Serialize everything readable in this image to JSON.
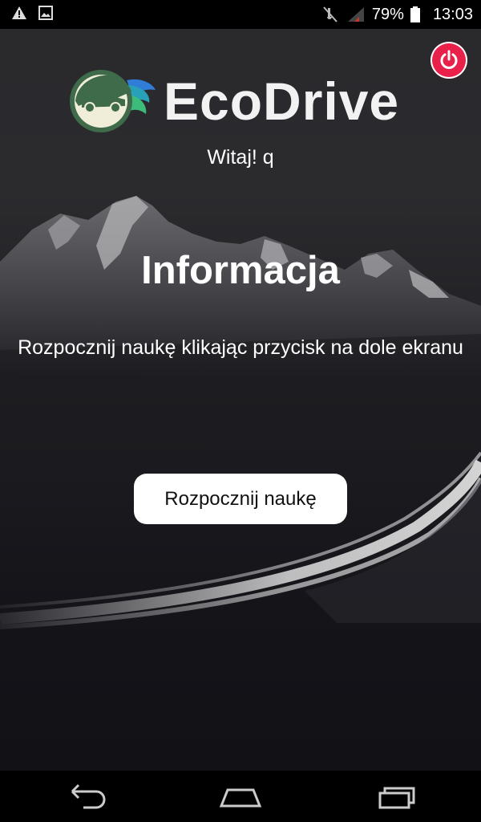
{
  "status_bar": {
    "battery_percent": "79%",
    "time": "13:03",
    "icons": [
      "warning-icon",
      "image-icon",
      "mute-icon",
      "signal-icon",
      "battery-icon"
    ]
  },
  "app": {
    "logo_text": "EcoDrive",
    "greeting": "Witaj! q",
    "info_title": "Informacja",
    "info_text": "Rozpocznij naukę klikając przycisk na dole ekranu",
    "start_button": "Rozpocznij naukę",
    "colors": {
      "power_button": "#e8204a",
      "logo_green": "#3f6b4a",
      "logo_cream": "#f0edd8"
    }
  },
  "nav_bar": {
    "icons": [
      "back-icon",
      "home-icon",
      "recent-apps-icon"
    ]
  }
}
